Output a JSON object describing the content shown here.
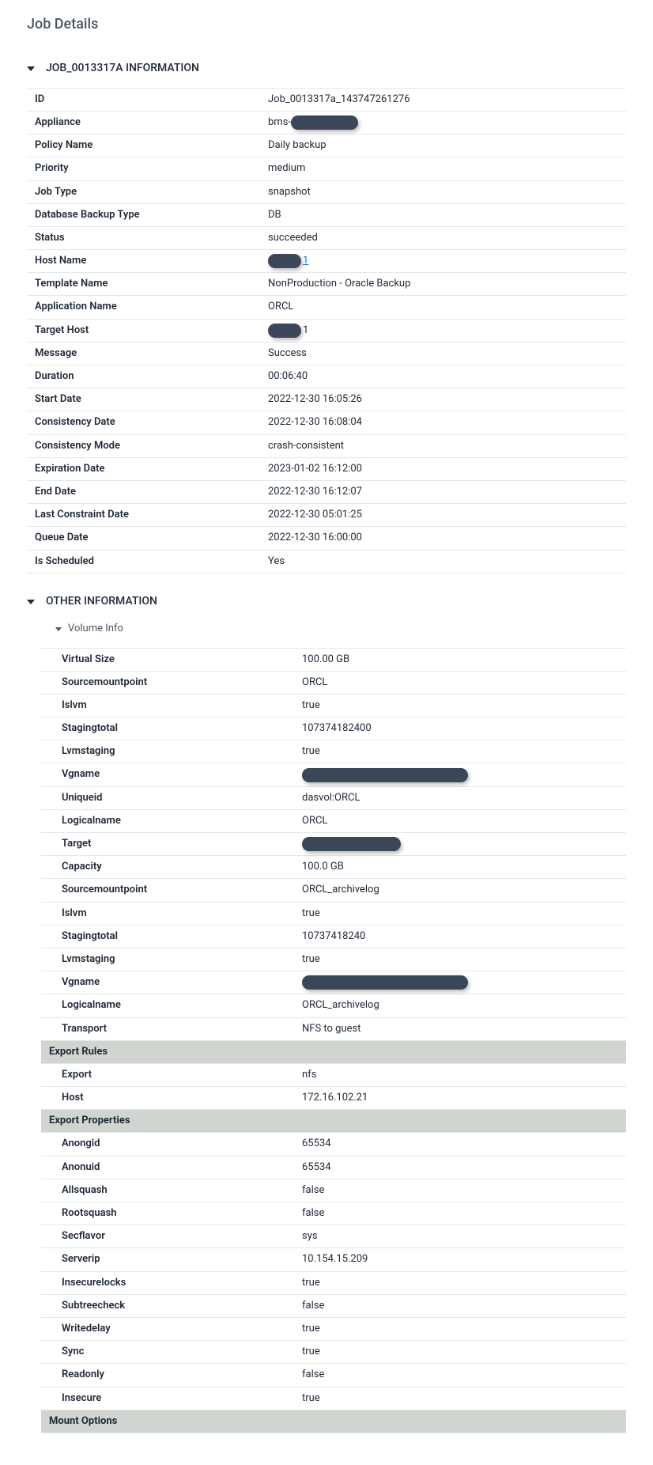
{
  "pageTitle": "Job Details",
  "sections": {
    "jobInfo": {
      "title": "JOB_0013317A INFORMATION",
      "rows": [
        {
          "label": "ID",
          "value": "Job_0013317a_143747261276"
        },
        {
          "label": "Appliance",
          "prefix": "bms-",
          "redact": "md"
        },
        {
          "label": "Policy Name",
          "value": "Daily backup"
        },
        {
          "label": "Priority",
          "value": "medium"
        },
        {
          "label": "Job Type",
          "value": "snapshot"
        },
        {
          "label": "Database Backup Type",
          "value": "DB"
        },
        {
          "label": "Status",
          "value": "succeeded"
        },
        {
          "label": "Host Name",
          "redact": "sm",
          "linkSuffix": "1"
        },
        {
          "label": "Template Name",
          "value": "NonProduction - Oracle Backup"
        },
        {
          "label": "Application Name",
          "value": "ORCL"
        },
        {
          "label": "Target Host",
          "redact": "sm",
          "suffix": "1"
        },
        {
          "label": "Message",
          "value": "Success"
        },
        {
          "label": "Duration",
          "value": "00:06:40"
        },
        {
          "label": "Start Date",
          "value": "2022-12-30 16:05:26"
        },
        {
          "label": "Consistency Date",
          "value": "2022-12-30 16:08:04"
        },
        {
          "label": "Consistency Mode",
          "value": "crash-consistent"
        },
        {
          "label": "Expiration Date",
          "value": "2023-01-02 16:12:00"
        },
        {
          "label": "End Date",
          "value": "2022-12-30 16:12:07"
        },
        {
          "label": "Last Constraint Date",
          "value": "2022-12-30 05:01:25"
        },
        {
          "label": "Queue Date",
          "value": "2022-12-30 16:00:00"
        },
        {
          "label": "Is Scheduled",
          "value": "Yes"
        }
      ]
    },
    "otherInfo": {
      "title": "OTHER INFORMATION",
      "volumeSubtitle": "Volume Info",
      "rows": [
        {
          "label": "Virtual Size",
          "value": "100.00 GB"
        },
        {
          "label": "Sourcemountpoint",
          "value": "ORCL"
        },
        {
          "label": "Islvm",
          "value": "true"
        },
        {
          "label": "Stagingtotal",
          "value": "107374182400"
        },
        {
          "label": "Lvmstaging",
          "value": "true"
        },
        {
          "label": "Vgname",
          "redact": "xl"
        },
        {
          "label": "Uniqueid",
          "value": "dasvol:ORCL"
        },
        {
          "label": "Logicalname",
          "value": "ORCL"
        },
        {
          "label": "Target",
          "redact": "lg"
        },
        {
          "label": "Capacity",
          "value": "100.0 GB"
        },
        {
          "label": "Sourcemountpoint",
          "value": "ORCL_archivelog"
        },
        {
          "label": "Islvm",
          "value": "true"
        },
        {
          "label": "Stagingtotal",
          "value": "10737418240"
        },
        {
          "label": "Lvmstaging",
          "value": "true"
        },
        {
          "label": "Vgname",
          "redact": "xl"
        },
        {
          "label": "Logicalname",
          "value": "ORCL_archivelog"
        },
        {
          "label": "Transport",
          "value": "NFS to guest"
        },
        {
          "band": "Export Rules"
        },
        {
          "label": "Export",
          "value": "nfs"
        },
        {
          "label": "Host",
          "value": "172.16.102.21"
        },
        {
          "band": "Export Properties"
        },
        {
          "label": "Anongid",
          "value": "65534"
        },
        {
          "label": "Anonuid",
          "value": "65534"
        },
        {
          "label": "Allsquash",
          "value": "false"
        },
        {
          "label": "Rootsquash",
          "value": "false"
        },
        {
          "label": "Secflavor",
          "value": "sys"
        },
        {
          "label": "Serverip",
          "value": "10.154.15.209"
        },
        {
          "label": "Insecurelocks",
          "value": "true"
        },
        {
          "label": "Subtreecheck",
          "value": "false"
        },
        {
          "label": "Writedelay",
          "value": "true"
        },
        {
          "label": "Sync",
          "value": "true"
        },
        {
          "label": "Readonly",
          "value": "false"
        },
        {
          "label": "Insecure",
          "value": "true"
        },
        {
          "band": "Mount Options"
        }
      ]
    }
  }
}
